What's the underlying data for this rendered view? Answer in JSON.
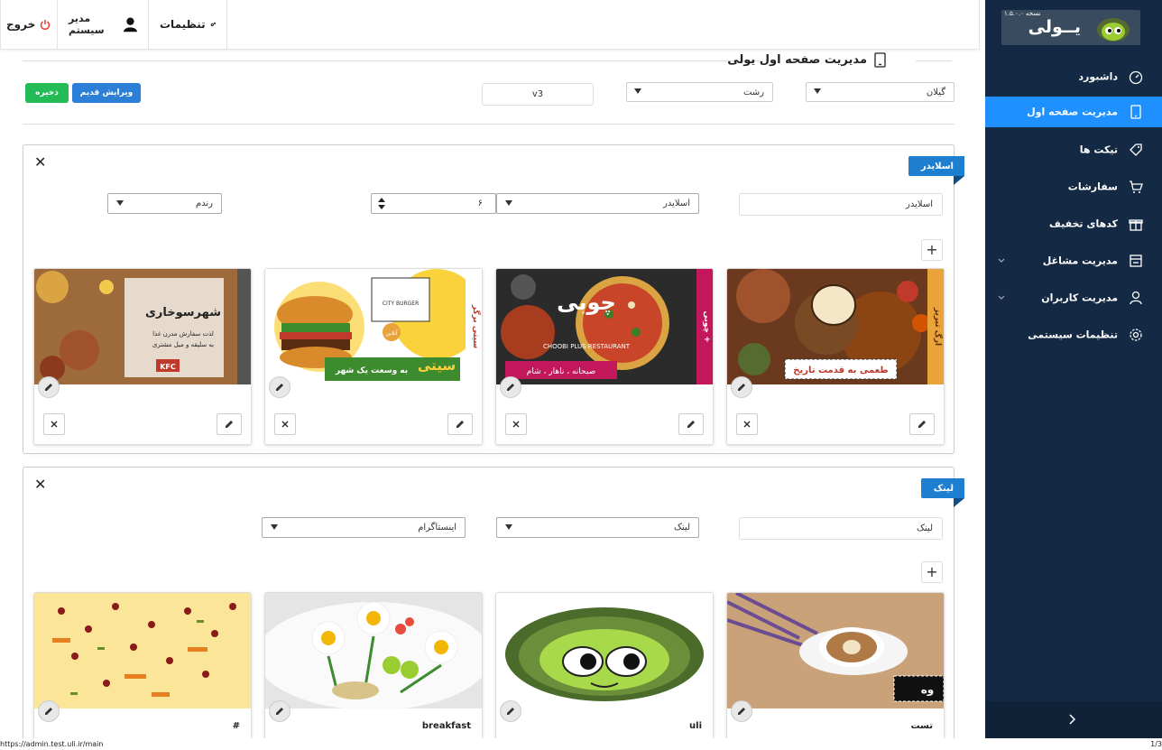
{
  "topbar": {
    "logout_label": "خروج",
    "admin_label": "مدیر سیستم",
    "settings_label": "تنظیمات"
  },
  "sidebar": {
    "brand": "یــولی",
    "version": "نسخه ۱.۵.۰.۰",
    "items": [
      {
        "label": "داشبورد",
        "icon": "dashboard-icon"
      },
      {
        "label": "مدیریت صفحه اول",
        "icon": "mobile-icon",
        "active": true
      },
      {
        "label": "تیکت ها",
        "icon": "tag-icon"
      },
      {
        "label": "سفارشات",
        "icon": "cart-icon"
      },
      {
        "label": "کدهای تخفیف",
        "icon": "gift-icon"
      },
      {
        "label": "مدیریت مشاغل",
        "icon": "store-icon",
        "expandable": true
      },
      {
        "label": "مدیریت کاربران",
        "icon": "users-icon",
        "expandable": true
      },
      {
        "label": "تنظیمات سیستمی",
        "icon": "gear-icon"
      }
    ]
  },
  "page": {
    "title": "مدیریت صفحه اول یولی",
    "province": "گیلان",
    "city": "رشت",
    "version": "v3",
    "save_label": "ذخیره",
    "old_edit_label": "ویرایش قدیم"
  },
  "slider_section": {
    "ribbon": "اسلایدر",
    "name_value": "اسلایدر",
    "type_value": "اسلایدر",
    "count_value": "۶",
    "order_value": "رندم",
    "cards": [
      {
        "image": "restaurant-banner-1",
        "title": ""
      },
      {
        "image": "choobi-plus-pizza-banner",
        "title": ""
      },
      {
        "image": "city-burger-banner",
        "title": ""
      },
      {
        "image": "kfc-chicken-banner",
        "title": ""
      }
    ]
  },
  "link_section": {
    "ribbon": "لینک",
    "name_value": "لینک",
    "type_value": "لینک",
    "target_value": "اینستاگرام",
    "cards": [
      {
        "image": "coffee-lavender",
        "title": "تست"
      },
      {
        "image": "turtle-mascot",
        "title": "uli"
      },
      {
        "image": "egg-flower-breakfast",
        "title": "breakfast"
      },
      {
        "image": "saffron-rice",
        "title": "#"
      }
    ]
  },
  "banners": {
    "b1_tag": "طعمی به قدمت تاریخ",
    "b1_side": "ارگ تبریز",
    "b2_brand": "چوبی",
    "b2_sub": "CHOOBI PLUS RESTAURANT",
    "b2_tag": "صبحانه ، ناهار ، شام",
    "b2_side": "چوبی +",
    "b3_logo": "CITY BURGER",
    "b3_tag": "به وسعت یک شهر",
    "b3_brand": "سیتی",
    "b3_side": "سیتی برگر",
    "b3_bubble": "آنلاین",
    "b4_brand": "شهرسوخاری",
    "b4_line1": "لذت سفارش مدرن غذا",
    "b4_line2": "به سلیقه و میل مشتری",
    "b4_kfc": "KFC",
    "coffee_tag": "وه"
  },
  "statusbar": {
    "url": "https://admin.test.uli.ir/main",
    "page": "1/3"
  }
}
